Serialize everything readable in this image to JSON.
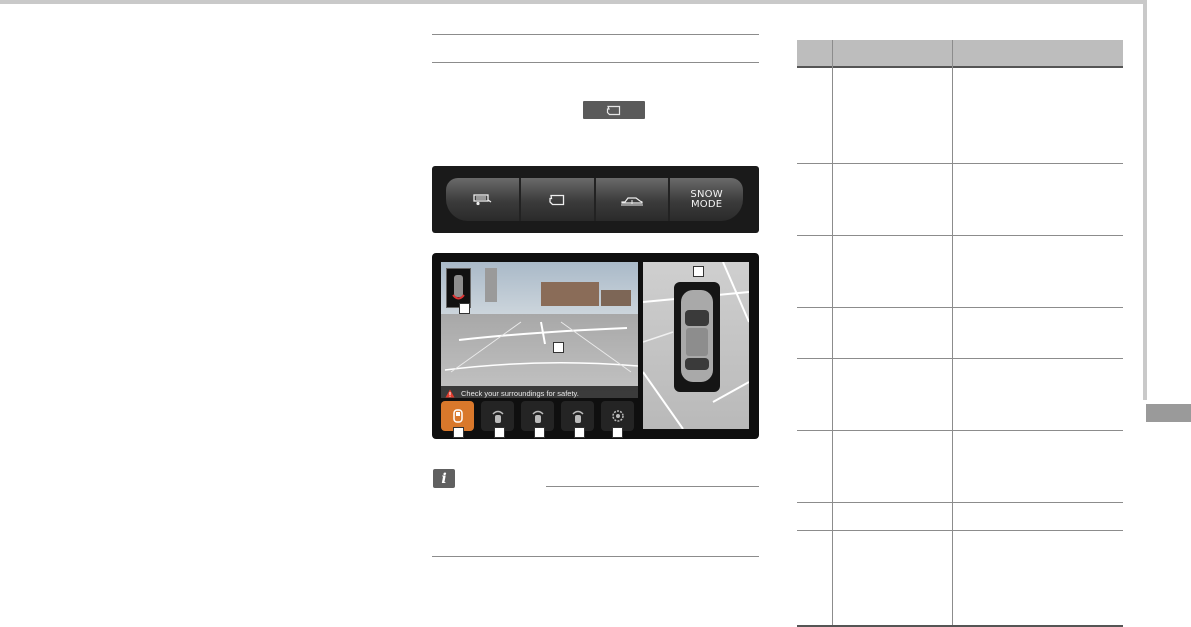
{
  "page": {
    "colors": {
      "rule": "#c9c9c9",
      "side_tab": "#9a9a9a",
      "table_header": "#bdbdbd",
      "active_camera_button": "#d9782b",
      "panel": "#1a1a1a"
    }
  },
  "middle": {
    "camera_chip_icon": "camera-icon",
    "button_panel": {
      "buttons": [
        {
          "icon": "trailer-icon"
        },
        {
          "icon": "camera-icon"
        },
        {
          "icon": "vehicle-raise-icon"
        },
        {
          "label_line1": "SNOW",
          "label_line2": "MODE"
        }
      ]
    },
    "camera_screen": {
      "warning_text": "Check your surroundings for safety.",
      "warning_icon": "warning-triangle-icon",
      "view_buttons": [
        {
          "icon": "front-view-icon",
          "active": true
        },
        {
          "icon": "left-view-icon",
          "active": false
        },
        {
          "icon": "right-view-icon",
          "active": false
        },
        {
          "icon": "rear-view-icon",
          "active": false
        },
        {
          "icon": "settings-icon",
          "active": false
        }
      ]
    },
    "note_icon": "info-icon"
  },
  "table": {
    "row_count": 8
  }
}
